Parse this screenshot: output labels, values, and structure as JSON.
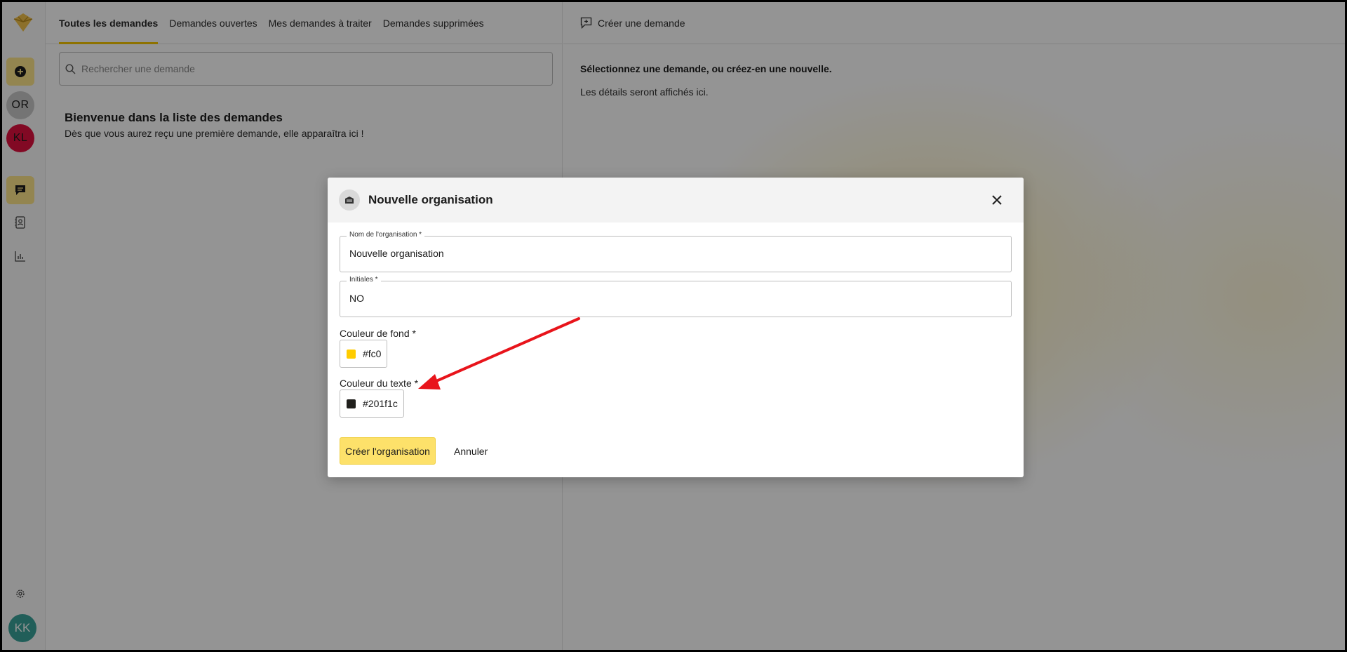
{
  "tabs": [
    {
      "label": "Toutes les demandes"
    },
    {
      "label": "Demandes ouvertes"
    },
    {
      "label": "Mes demandes à traiter"
    },
    {
      "label": "Demandes supprimées"
    }
  ],
  "search": {
    "placeholder": "Rechercher une demande"
  },
  "welcome": {
    "title": "Bienvenue dans la liste des demandes",
    "subtitle": "Dès que vous aurez reçu une première demande, elle apparaîtra ici !"
  },
  "detail": {
    "create_label": "Créer une demande",
    "select_text": "Sélectionnez une demande, ou créez-en une nouvelle.",
    "details_text": "Les détails seront affichés ici."
  },
  "rail": {
    "orgs": [
      {
        "initials": "OR",
        "bg": "#c8c8c8",
        "fg": "#1c1c1c"
      },
      {
        "initials": "KL",
        "bg": "#e0103e",
        "fg": "#1c1c1c"
      }
    ],
    "user_initials": "KK",
    "icons": [
      "add-icon",
      "chat-icon",
      "contacts-icon",
      "chart-icon",
      "gear-icon"
    ]
  },
  "modal": {
    "title": "Nouvelle organisation",
    "name_label": "Nom de l'organisation *",
    "name_value": "Nouvelle organisation",
    "initials_label": "Initiales *",
    "initials_value": "NO",
    "bg_color_label": "Couleur de fond *",
    "bg_color_value": "#fc0",
    "text_color_label": "Couleur du texte *",
    "text_color_value": "#201f1c",
    "submit_label": "Créer l'organisation",
    "cancel_label": "Annuler"
  },
  "colors": {
    "accent": "#f5c400",
    "button_yellow": "#fde16a",
    "annotation_arrow": "#e8141b"
  }
}
